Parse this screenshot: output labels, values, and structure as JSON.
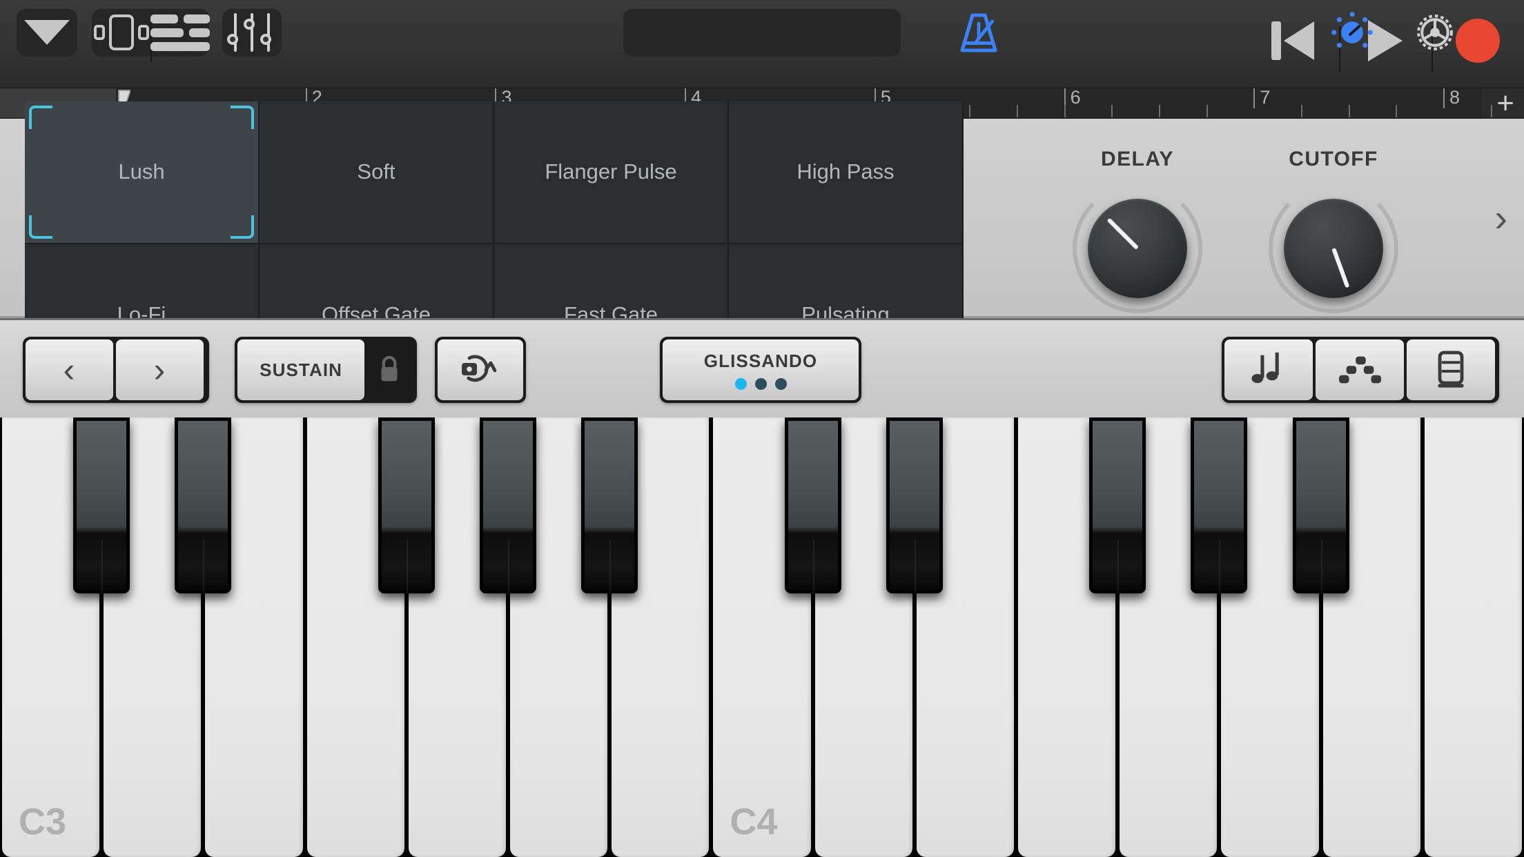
{
  "toolbar": {
    "browser_button": "browser-chevron",
    "tracks_button": "tracks-view",
    "list_button": "list-view",
    "mixer_button": "track-controls",
    "rewind_button": "rewind",
    "play_button": "play",
    "record_button": "record",
    "metronome_button": "metronome",
    "fx_button": "fx-knob",
    "settings_button": "settings-gear"
  },
  "ruler": {
    "bars": [
      "2",
      "3",
      "4",
      "5",
      "6",
      "7",
      "8"
    ],
    "add_label": "+",
    "playhead_position": "1"
  },
  "fx": {
    "pads": [
      {
        "label": "Lush",
        "selected": true
      },
      {
        "label": "Soft",
        "selected": false
      },
      {
        "label": "Flanger Pulse",
        "selected": false
      },
      {
        "label": "High Pass",
        "selected": false
      },
      {
        "label": "Lo-Fi",
        "selected": false
      },
      {
        "label": "Offset Gate",
        "selected": false
      },
      {
        "label": "Fast Gate",
        "selected": false
      },
      {
        "label": "Pulsating",
        "selected": false
      }
    ],
    "knobs": [
      {
        "label": "DELAY",
        "angle": -45
      },
      {
        "label": "CUTOFF",
        "angle": 160
      }
    ],
    "next_label": "›",
    "selection_color": "#4ec3e0"
  },
  "keybar": {
    "octave_down": "‹",
    "octave_up": "›",
    "sustain_label": "SUSTAIN",
    "lock_icon": "lock-icon",
    "rotate_label": "pitch-rotate",
    "glissando_label": "GLISSANDO",
    "glissando_dots": [
      true,
      false,
      false
    ],
    "arpeggiator_label": "arpeggiator",
    "chords_label": "chords",
    "keysize_label": "key-size",
    "active_dot_color": "#19b6f0"
  },
  "piano": {
    "white_key_labels": {
      "0": "C3",
      "7": "C4"
    },
    "white_key_count": 15,
    "black_key_pattern": [
      0,
      1,
      3,
      4,
      5,
      7,
      8,
      10,
      11,
      12
    ]
  }
}
